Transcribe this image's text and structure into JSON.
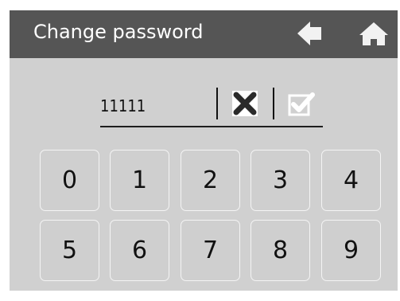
{
  "header": {
    "title": "Change password",
    "back_icon": "back-arrow-icon",
    "home_icon": "home-icon"
  },
  "entry": {
    "value": "11111",
    "clear_icon": "clear-x-icon",
    "confirm_icon": "checkmark-icon"
  },
  "keypad": {
    "keys": [
      "0",
      "1",
      "2",
      "3",
      "4",
      "5",
      "6",
      "7",
      "8",
      "9"
    ]
  },
  "colors": {
    "header_bg": "#555555",
    "screen_bg": "#d0d0d0",
    "icon_fill": "#f2f2f2",
    "text": "#111111"
  }
}
